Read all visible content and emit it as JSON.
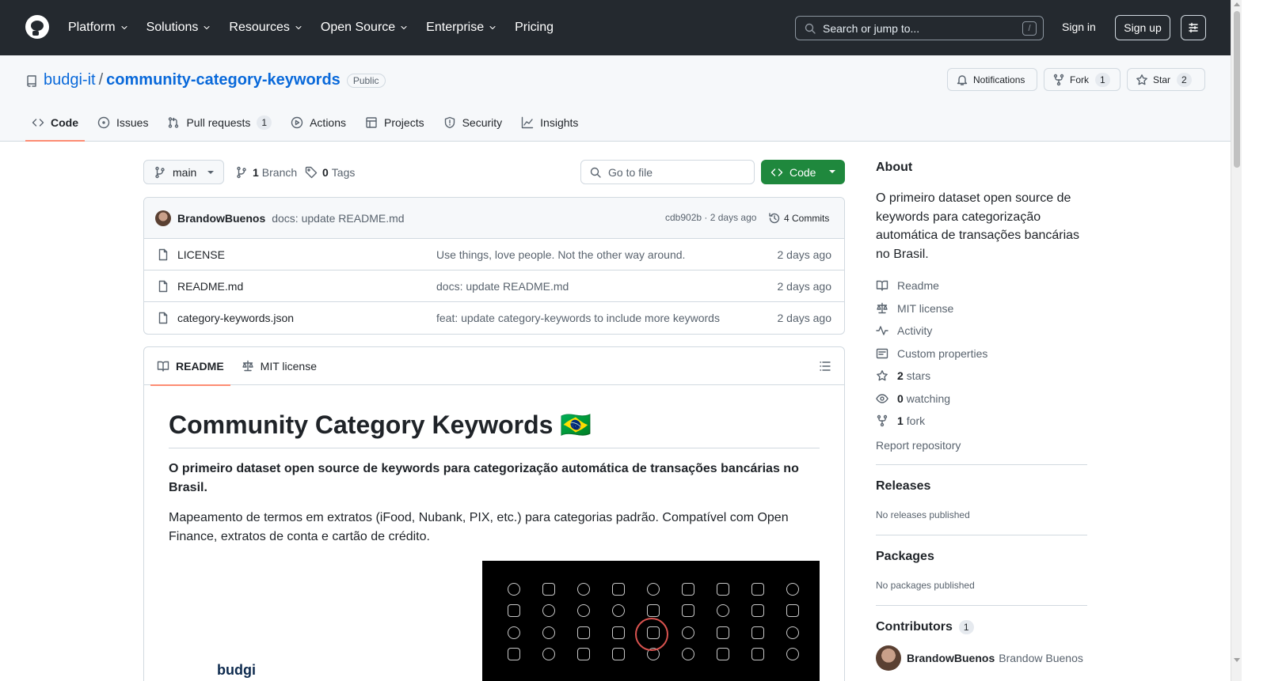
{
  "header": {
    "nav": [
      "Platform",
      "Solutions",
      "Resources",
      "Open Source",
      "Enterprise",
      "Pricing"
    ],
    "nav_has_dropdown": [
      true,
      true,
      true,
      true,
      true,
      false
    ],
    "search_placeholder": "Search or jump to...",
    "search_shortcut": "/",
    "sign_in": "Sign in",
    "sign_up": "Sign up"
  },
  "repo": {
    "owner": "budgi-it",
    "separator": "/",
    "name": "community-category-keywords",
    "visibility": "Public",
    "notifications_label": "Notifications",
    "fork_label": "Fork",
    "fork_count": "1",
    "star_label": "Star",
    "star_count": "2"
  },
  "tabs": [
    {
      "label": "Code",
      "icon": "code-icon",
      "active": true
    },
    {
      "label": "Issues",
      "icon": "issue-icon"
    },
    {
      "label": "Pull requests",
      "icon": "pull-request-icon",
      "count": "1"
    },
    {
      "label": "Actions",
      "icon": "play-icon"
    },
    {
      "label": "Projects",
      "icon": "table-icon"
    },
    {
      "label": "Security",
      "icon": "shield-icon"
    },
    {
      "label": "Insights",
      "icon": "graph-icon"
    }
  ],
  "toolbar": {
    "branch": "main",
    "branch_count": "1",
    "branch_label": "Branch",
    "tag_count": "0",
    "tag_label": "Tags",
    "go_to_file": "Go to file",
    "code_button": "Code"
  },
  "latest_commit": {
    "author": "BrandowBuenos",
    "message": "docs: update README.md",
    "hash_age": "cdb902b · 2 days ago",
    "commits": "4 Commits"
  },
  "files": [
    {
      "name": "LICENSE",
      "message": "Use things, love people. Not the other way around.",
      "age": "2 days ago"
    },
    {
      "name": "README.md",
      "message": "docs: update README.md",
      "age": "2 days ago"
    },
    {
      "name": "category-keywords.json",
      "message": "feat: update category-keywords to include more keywords",
      "age": "2 days ago"
    }
  ],
  "readme": {
    "tab_readme": "README",
    "tab_license": "MIT license",
    "title": "Community Category Keywords 🇧🇷",
    "lead": "O primeiro dataset open source de keywords para categorização automática de transações bancárias no Brasil.",
    "paragraph": "Mapeamento de termos em extratos (iFood, Nubank, PIX, etc.) para categorias padrão. Compatível com Open Finance, extratos de conta e cartão de crédito.",
    "logo_text": "budgi"
  },
  "sidebar": {
    "about_title": "About",
    "description": "O primeiro dataset open source de keywords para categorização automática de transações bancárias no Brasil.",
    "readme": "Readme",
    "license": "MIT license",
    "activity": "Activity",
    "custom_properties": "Custom properties",
    "stars_count": "2",
    "stars_label": "stars",
    "watching_count": "0",
    "watching_label": "watching",
    "fork_count": "1",
    "fork_label": "fork",
    "report": "Report repository",
    "releases_title": "Releases",
    "releases_empty": "No releases published",
    "packages_title": "Packages",
    "packages_empty": "No packages published",
    "contributors_title": "Contributors",
    "contributors_count": "1",
    "contributor_login": "BrandowBuenos",
    "contributor_name": "Brandow Buenos"
  },
  "colors": {
    "header_bg": "#24292f",
    "link": "#0969da",
    "code_button": "#1f883d",
    "tab_underline": "#fd8c73"
  }
}
